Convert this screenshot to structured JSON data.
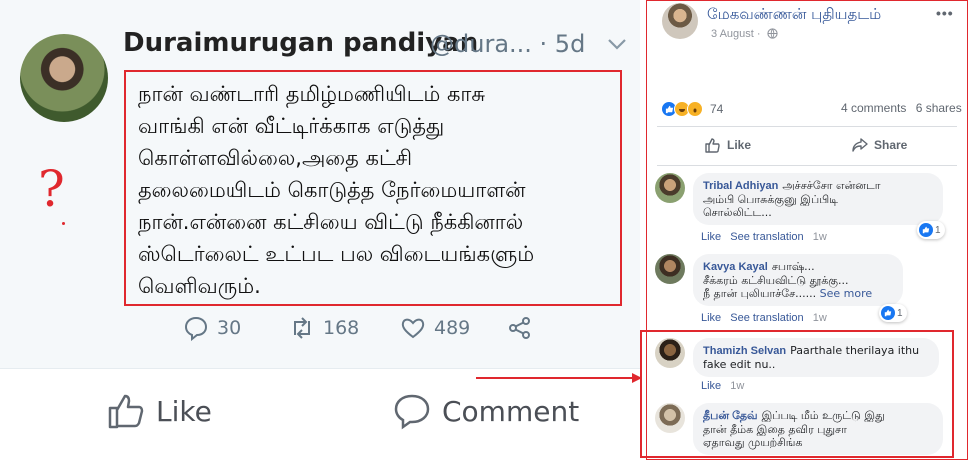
{
  "tweet": {
    "name": "Duraimurugan pandiyan",
    "handle": "@dura...",
    "time": "· 5d",
    "lines": [
      "நான் வண்டாரி தமிழ்மணியிடம் காசு",
      "வாங்கி என் வீட்டிர்க்காக எடுத்து",
      "கொள்ளவில்லை,அதை கட்சி",
      "தலைமையிடம் கொடுத்த நேர்மையாளன்",
      "நான்.என்னை கட்சியை விட்டு நீக்கினால்",
      "ஸ்டெர்லைட் உட்பட பல விடையங்களும்",
      "வெளிவரும்."
    ],
    "reply_count": "30",
    "retweet_count": "168",
    "like_count": "489",
    "annotation": "?",
    "bottom_like": "Like",
    "bottom_comment": "Comment"
  },
  "fb": {
    "author": "மேகவண்ணன் புதியதடம்",
    "date": "3 August ·",
    "more": "•••",
    "reaction_count": "74",
    "comments": "4 comments",
    "shares": "6 shares",
    "like_label": "Like",
    "share_label": "Share",
    "comment_list": [
      {
        "author": "Tribal Adhiyan",
        "line1": "அச்சச்சோ என்னடா",
        "line2": "அம்பி பொசுக்குனு இப்பிடி",
        "line3": "சொல்லிட்ட...",
        "like": "Like",
        "translate": "See translation",
        "time": "1w",
        "reacts": "1"
      },
      {
        "author": "Kavya Kayal",
        "line1": "சபாஷ்...",
        "line2": "சீக்கரம் கட்சியவிட்டு தூக்கு...",
        "line3": "நீ தான் புலியாச்சே......",
        "see_more": "See more",
        "like": "Like",
        "translate": "See translation",
        "time": "1w",
        "reacts": "1"
      },
      {
        "author": "Thamizh Selvan",
        "line1": "Paarthale therilaya ithu",
        "line2": "fake edit nu..",
        "like": "Like",
        "time": "1w"
      },
      {
        "author": "தீபன் தேவ்",
        "line1": "இப்படி மீம் உருட்டு இது",
        "line2": "தான் தீம்க இதை தவிர புதுசா",
        "line3": "ஏதாவது முயற்சிங்க"
      }
    ]
  },
  "colors": {
    "highlight_red": "#e0282e",
    "fb_blue": "#385898",
    "tw_gray": "#657786"
  }
}
